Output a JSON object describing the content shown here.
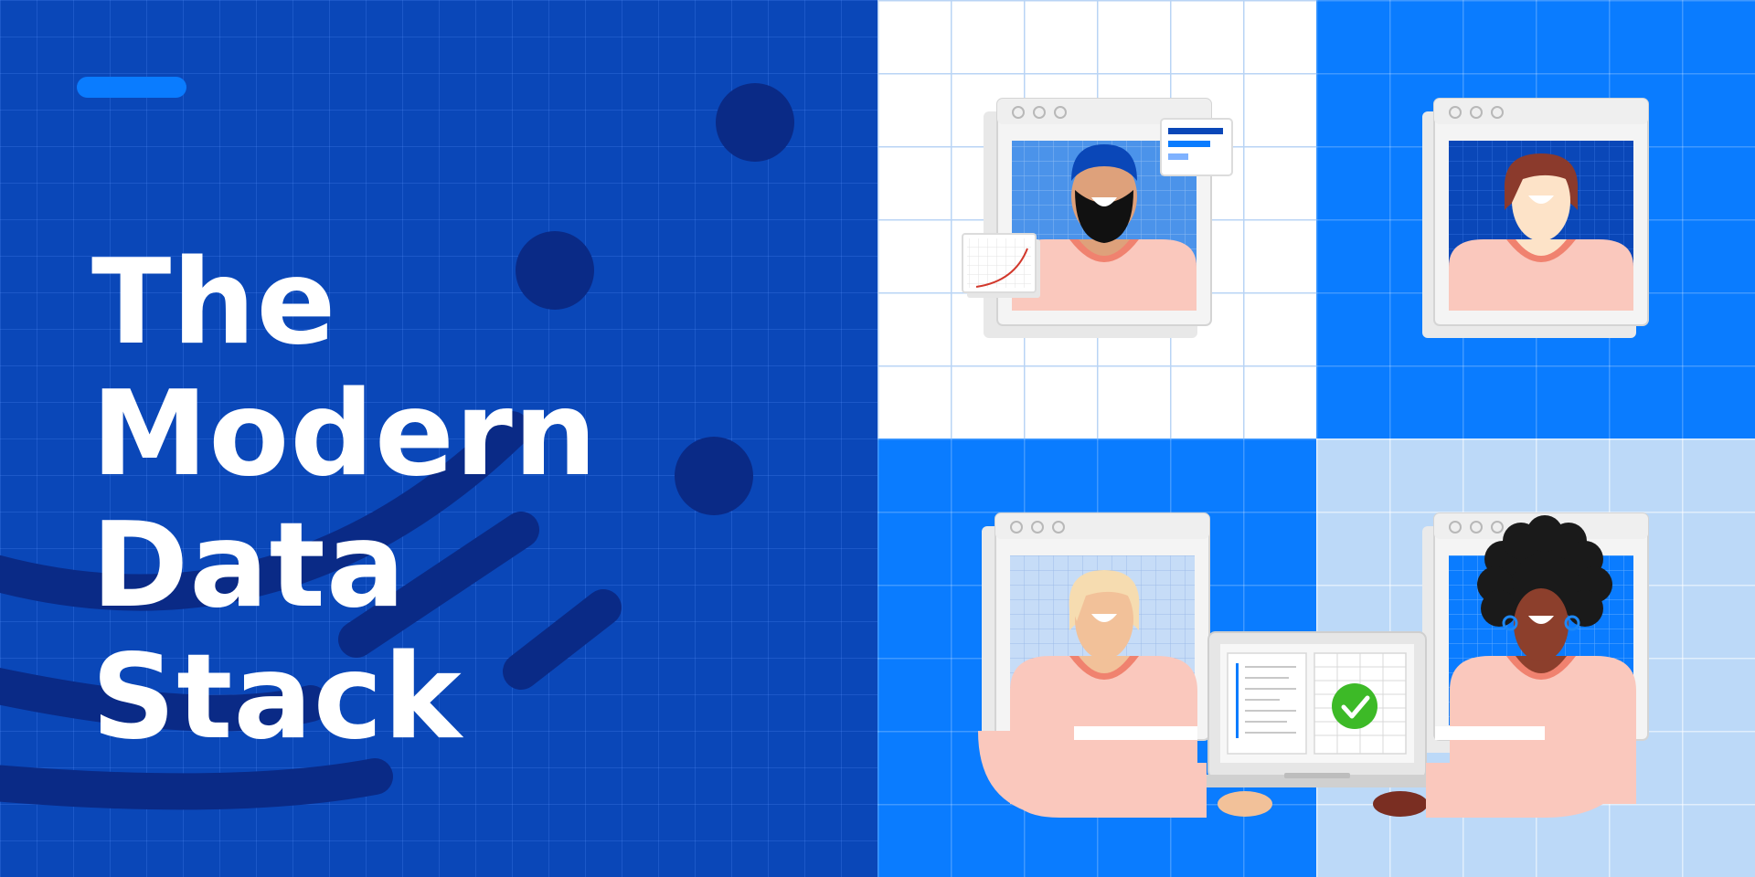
{
  "title": {
    "lines": [
      "The",
      "Modern",
      "Data",
      "Stack"
    ]
  },
  "colors": {
    "navy_blue": "#0a47b8",
    "bright_blue": "#0a7cff",
    "light_blue": "#bcd9f8",
    "dark_accent": "#0a2a86",
    "skin_pink": "#fac8bd",
    "collar_coral": "#f0826f",
    "check_green": "#3dba27"
  },
  "icons": [
    "window-controls",
    "bar-list-card",
    "line-chart-card",
    "laptop",
    "checkmark-icon",
    "document-icon",
    "spreadsheet-icon"
  ]
}
